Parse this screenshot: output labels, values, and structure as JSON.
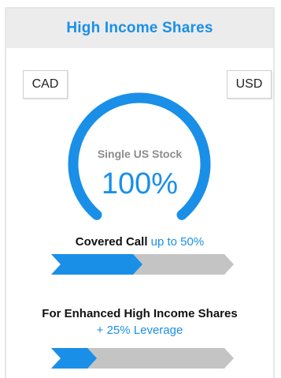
{
  "header": {
    "title": "High Income Shares"
  },
  "currency": {
    "cad_label": "CAD",
    "usd_label": "USD"
  },
  "gauge": {
    "subtitle": "Single US Stock",
    "value_text": "100%",
    "level": 1.0,
    "color": "#1a8fe8"
  },
  "covered_call": {
    "label_bold": "Covered  Call",
    "label_blue": "up to 50%",
    "fill_fraction": 0.5
  },
  "enhanced": {
    "title": "For Enhanced High Income Shares",
    "subtitle": "+ 25% Leverage",
    "fill_fraction": 0.25
  },
  "colors": {
    "accent": "#1a8fe8",
    "track": "#c4c4c4",
    "header_bg": "#ececec"
  }
}
